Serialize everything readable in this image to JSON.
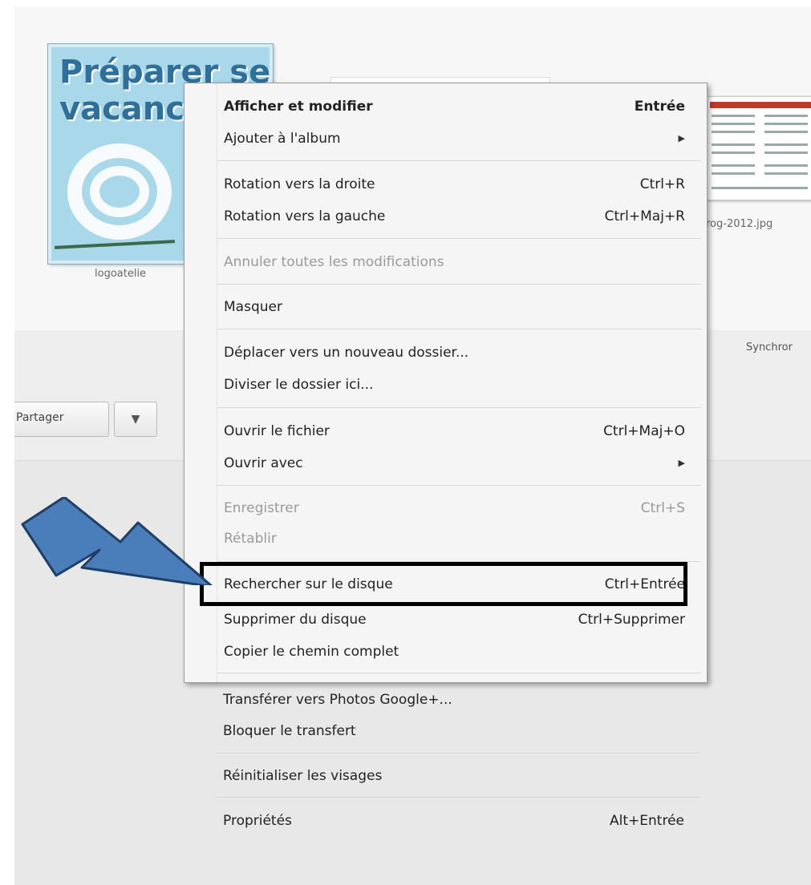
{
  "thumbnails": {
    "logo_title": "Préparer ses vacances",
    "logo_caption": "logoatelie",
    "doc_caption": "rog-2012.jpg"
  },
  "toolbar": {
    "sync_label": "Synchror",
    "share_label": "Partager",
    "share_dropdown_icon": "triangle-down-icon"
  },
  "context_menu": {
    "items": [
      {
        "label": "Afficher et modifier",
        "shortcut": "Entrée",
        "bold": true
      },
      {
        "label": "Ajouter à l'album",
        "submenu": true
      },
      {
        "label": "Rotation vers la droite",
        "shortcut": "Ctrl+R"
      },
      {
        "label": "Rotation vers la gauche",
        "shortcut": "Ctrl+Maj+R"
      },
      {
        "label": "Annuler toutes les modifications",
        "disabled": true
      },
      {
        "label": "Masquer"
      },
      {
        "label": "Déplacer vers un nouveau dossier..."
      },
      {
        "label": "Diviser le dossier ici..."
      },
      {
        "label": "Ouvrir le fichier",
        "shortcut": "Ctrl+Maj+O"
      },
      {
        "label": "Ouvrir avec",
        "submenu": true
      },
      {
        "label": "Enregistrer",
        "shortcut": "Ctrl+S",
        "disabled": true
      },
      {
        "label": "Rétablir",
        "disabled": true
      },
      {
        "label": "Rechercher sur le disque",
        "shortcut": "Ctrl+Entrée",
        "highlighted": true
      },
      {
        "label": "Supprimer du disque",
        "shortcut": "Ctrl+Supprimer"
      },
      {
        "label": "Copier le chemin complet"
      },
      {
        "label": "Transférer vers Photos Google+..."
      },
      {
        "label": "Bloquer le transfert"
      },
      {
        "label": "Réinitialiser les visages"
      },
      {
        "label": "Propriétés",
        "shortcut": "Alt+Entrée"
      }
    ]
  },
  "annotation": {
    "arrow_color": "#4a7ebb",
    "arrow_outline": "#1f3f66",
    "highlight_color": "#000000"
  }
}
